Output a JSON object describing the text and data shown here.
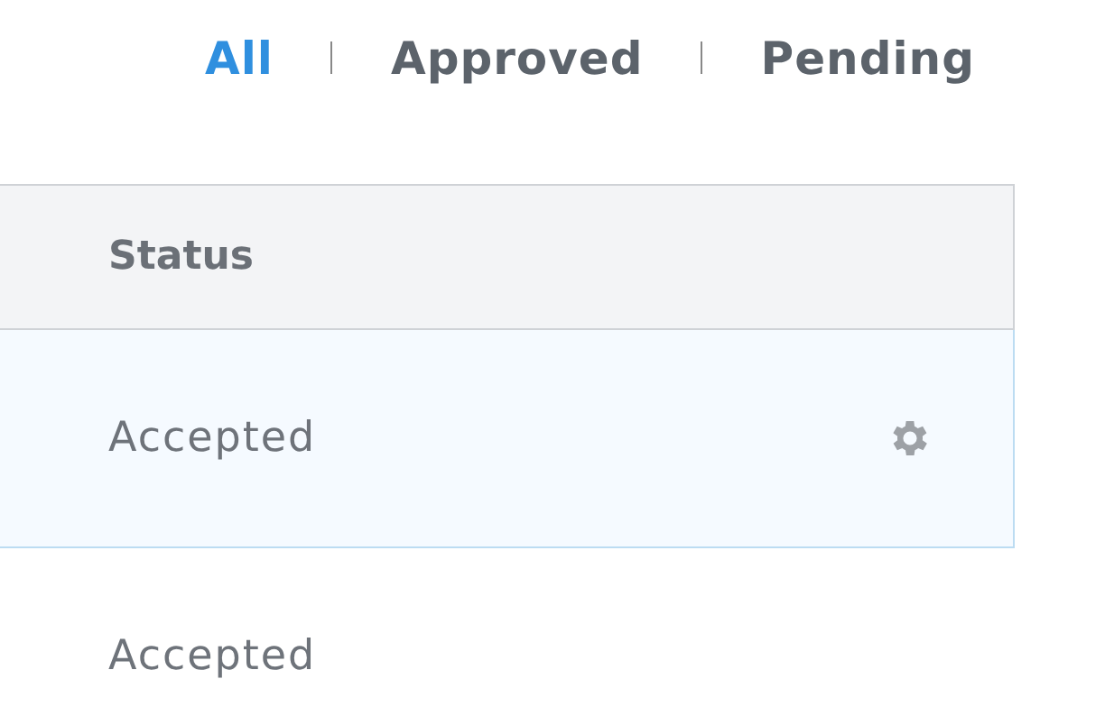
{
  "filters": [
    {
      "label": "All",
      "selected": true
    },
    {
      "label": "Approved",
      "selected": false
    },
    {
      "label": "Pending",
      "selected": false
    }
  ],
  "table": {
    "columns": [
      "Status"
    ],
    "rows": [
      {
        "status": "Accepted",
        "selected": true
      },
      {
        "status": "Accepted",
        "selected": false
      }
    ]
  }
}
